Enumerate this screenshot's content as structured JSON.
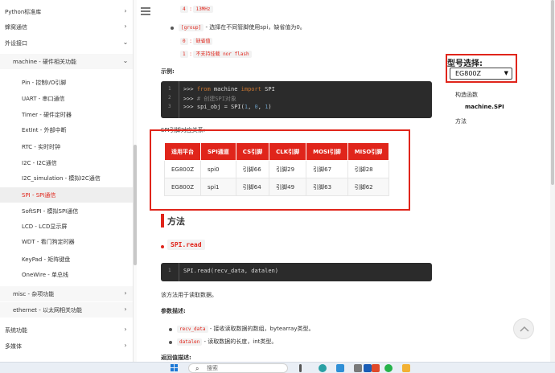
{
  "sidebar": {
    "items": [
      {
        "label": "Python标准库",
        "chevron": "right",
        "level": 0
      },
      {
        "label": "蜂窝通信",
        "chevron": "right",
        "level": 0
      },
      {
        "label": "外设接口",
        "chevron": "down",
        "level": 0
      },
      {
        "label": "machine - 硬件相关功能",
        "chevron": "down",
        "level": 1
      },
      {
        "label": "Pin - 控制I/O引脚",
        "level": 2
      },
      {
        "label": "UART - 串口通信",
        "level": 2
      },
      {
        "label": "Timer - 硬件定时器",
        "level": 2
      },
      {
        "label": "ExtInt - 外部中断",
        "level": 2
      },
      {
        "label": "RTC - 实时时钟",
        "level": 2
      },
      {
        "label": "I2C - I2C通信",
        "level": 2
      },
      {
        "label": "I2C_simulation - 模拟I2C通信",
        "level": 2
      },
      {
        "label": "SPI - SPI通信",
        "level": 2,
        "active": true
      },
      {
        "label": "SoftSPI - 模拟SPI通信",
        "level": 2
      },
      {
        "label": "LCD - LCD显示屏",
        "level": 2
      },
      {
        "label": "WDT - 看门狗定时器",
        "level": 2
      },
      {
        "label": "KeyPad - 矩阵键盘",
        "level": 2
      },
      {
        "label": "OneWire - 单总线",
        "level": 2
      },
      {
        "label": "misc - 杂项功能",
        "chevron": "right",
        "level": 1
      },
      {
        "label": "ethernet - 以太网相关功能",
        "chevron": "right",
        "level": 1
      },
      {
        "label": "系统功能",
        "chevron": "right",
        "level": 0
      },
      {
        "label": "多媒体",
        "chevron": "right",
        "level": 0
      }
    ]
  },
  "content": {
    "top_code_a": "4",
    "top_code_b": "13MHz",
    "group_code": "[group]",
    "group_desc": "- 选择在不同管脚使用spi，缺省值为0。",
    "opt0_code": "0",
    "opt0_desc": "缺省值",
    "opt1_code": "1",
    "opt1_desc": "不支持挂载 nor flash",
    "example_heading": "示例:",
    "example_lines": [
      {
        "n": "1",
        "prompt": ">>> ",
        "kw": "from",
        "mid": " machine ",
        "kw2": "import",
        "rest": " SPI"
      },
      {
        "n": "2",
        "prompt": ">>> ",
        "comment": "# 创建SPI对象"
      },
      {
        "n": "3",
        "prompt": ">>> ",
        "pre": "spi_obj = SPI(",
        "a": "1",
        "c1": ", ",
        "b": "0",
        "c2": ", ",
        "c": "1",
        "post": ")"
      }
    ],
    "pin_table_title": "SPI引脚对应关系:",
    "pin_table": {
      "headers": [
        "适用平台",
        "SPI通道",
        "CS引脚",
        "CLK引脚",
        "MOSI引脚",
        "MISO引脚"
      ],
      "rows": [
        [
          "EG800Z",
          "spi0",
          "引脚66",
          "引脚29",
          "引脚67",
          "引脚28"
        ],
        [
          "EG800Z",
          "spi1",
          "引脚64",
          "引脚49",
          "引脚63",
          "引脚62"
        ]
      ]
    },
    "methods_heading": "方法",
    "method_name": "SPI.read",
    "method_sig": {
      "n": "1",
      "code": "SPI.read(recv_data, datalen)"
    },
    "method_desc": "该方法用于读取数据。",
    "params_heading": "参数描述:",
    "params": [
      {
        "code": "recv_data",
        "desc": "- 接收读取数据的数组，bytearray类型。"
      },
      {
        "code": "datalen",
        "desc": "- 读取数据的长度，int类型。"
      }
    ],
    "returns_heading": "返回值描述:"
  },
  "right_panel": {
    "model_label": "型号选择:",
    "model_selected": "EG800Z",
    "toc": [
      "构造函数",
      "machine.SPI",
      "方法"
    ]
  },
  "taskbar": {
    "search_placeholder": "搜索"
  },
  "colors": {
    "accent": "#e0251b",
    "code_bg": "#2b2b2b"
  }
}
